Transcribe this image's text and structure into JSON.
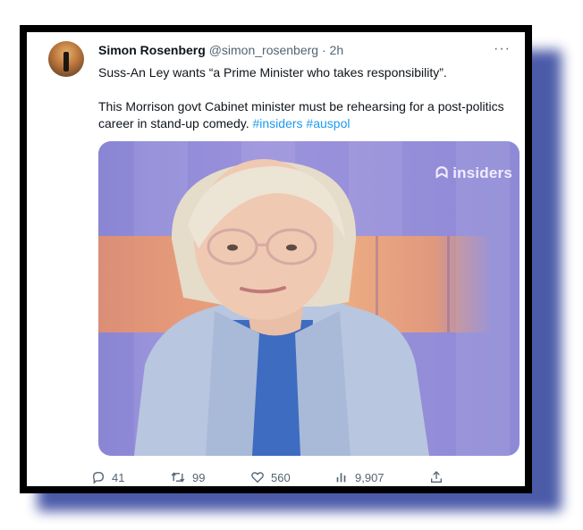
{
  "tweet": {
    "author_name": "Simon Rosenberg",
    "handle": "@simon_rosenberg",
    "separator": "·",
    "time": "2h",
    "more_label": "···",
    "line1": "Suss-An Ley wants “a Prime Minister who takes responsibility”.",
    "line2_text": "This Morrison govt Cabinet minister must be rehearsing for a post-politics career in stand-up comedy.",
    "hashtags": [
      "#insiders",
      "#auspol"
    ],
    "media": {
      "logo_text": "insiders",
      "logo_icon": "abc-logo-icon"
    },
    "actions": {
      "replies": "41",
      "retweets": "99",
      "likes": "560",
      "views": "9,907"
    }
  },
  "colors": {
    "frame": "#000000",
    "shadow": "#2c3f9a",
    "hashtag": "#1d9bf0",
    "text": "#0f1419",
    "muted": "#536471"
  }
}
